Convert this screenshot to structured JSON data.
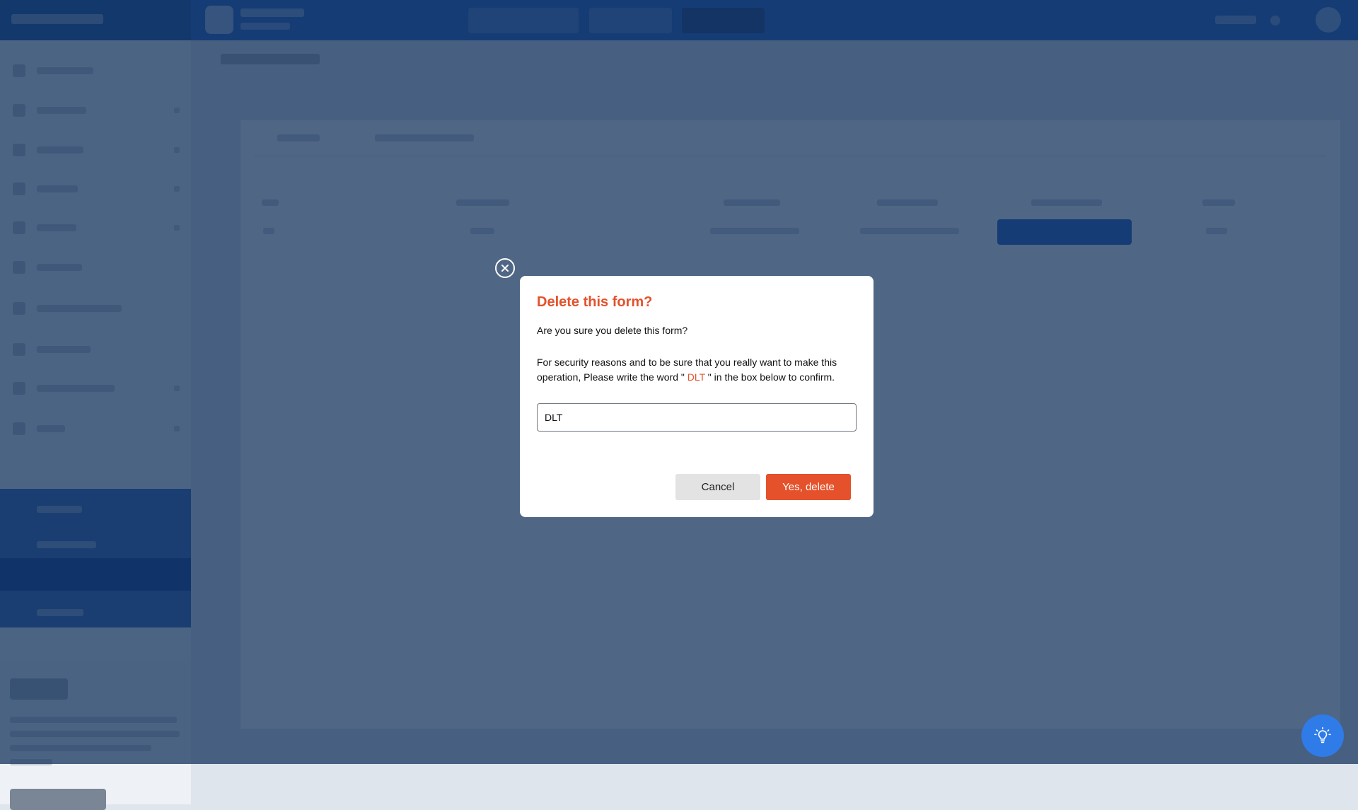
{
  "modal": {
    "title": "Delete this form?",
    "question": "Are you sure you delete this form?",
    "info_before": "For security reasons and to be sure that you really want to make this operation, Please write the word \"",
    "keyword": " DLT ",
    "info_after": "\" in the box below to confirm.",
    "input_value": "DLT",
    "cancel_label": "Cancel",
    "confirm_label": "Yes, delete"
  },
  "icons": {
    "close": "close-icon",
    "help": "lightbulb-icon"
  },
  "colors": {
    "accent": "#e4512a",
    "primary": "#1f5fbf",
    "overlay": "#12305a",
    "help_fab": "#2f7be8"
  }
}
